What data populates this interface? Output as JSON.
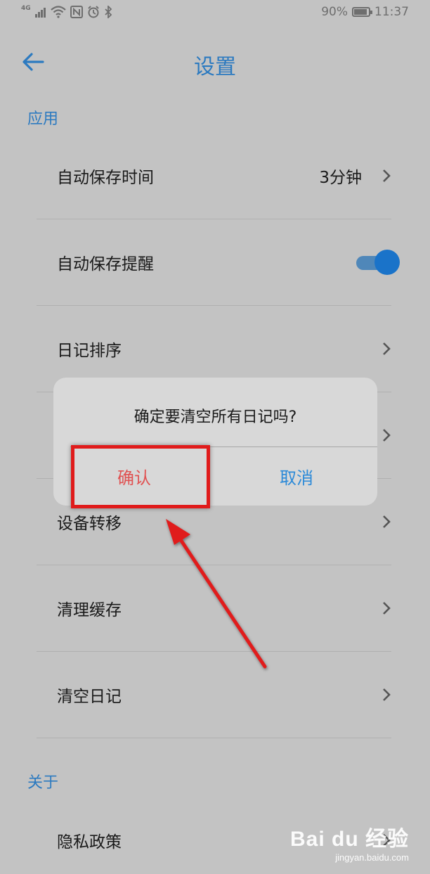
{
  "status_bar": {
    "network": "4G",
    "battery_percent": "90%",
    "time": "11:37"
  },
  "header": {
    "title": "设置",
    "back_icon": "arrow-left-icon"
  },
  "sections": {
    "app_label": "应用",
    "about_label": "关于"
  },
  "rows": [
    {
      "label": "自动保存时间",
      "value": "3分钟"
    },
    {
      "label": "自动保存提醒",
      "toggle": true
    },
    {
      "label": "日记排序"
    },
    {
      "label": ""
    },
    {
      "label": "设备转移"
    },
    {
      "label": "清理缓存"
    },
    {
      "label": "清空日记"
    },
    {
      "label": "隐私政策"
    }
  ],
  "dialog": {
    "message": "确定要清空所有日记吗?",
    "confirm_label": "确认",
    "cancel_label": "取消"
  },
  "colors": {
    "accent": "#2c7ac0",
    "confirm": "#e05252",
    "highlight": "#e01b1b"
  },
  "watermark": {
    "logo": "Bai du 经验",
    "url": "jingyan.baidu.com"
  }
}
